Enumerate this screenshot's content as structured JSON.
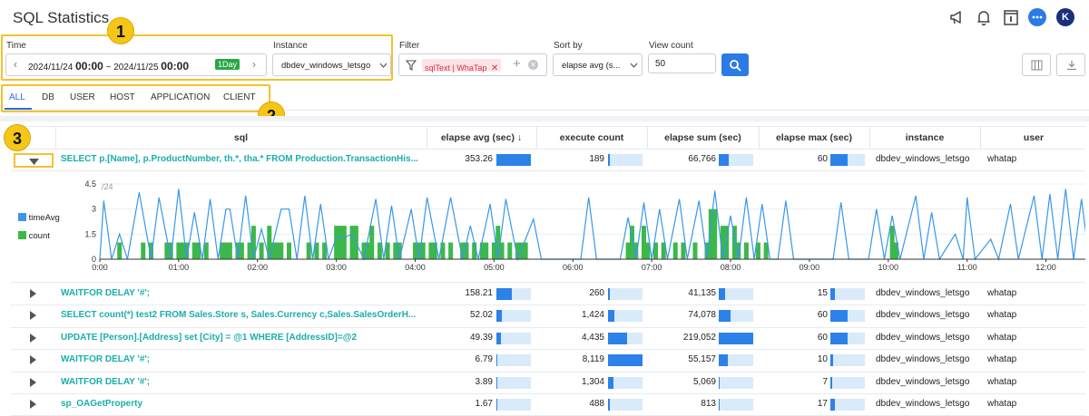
{
  "header": {
    "title": "SQL Statistics",
    "avatar_letter": "K"
  },
  "annotations": {
    "one": "1",
    "two": "2",
    "three": "3"
  },
  "filters": {
    "time_label": "Time",
    "time_start_date": "2024/11/24",
    "time_start_hm": "00:00",
    "time_sep": "~",
    "time_end_date": "2024/11/25",
    "time_end_hm": "00:00",
    "time_badge": "1Day",
    "instance_label": "Instance",
    "instance_value": "dbdev_windows_letsgo",
    "filter_label": "Filter",
    "filter_tag": "sqlText | WhaTap",
    "sort_label": "Sort by",
    "sort_value": "elapse avg (s...",
    "view_label": "View count",
    "view_value": "50"
  },
  "tabs": [
    "ALL",
    "DB",
    "USER",
    "HOST",
    "APPLICATION",
    "CLIENT"
  ],
  "columns": [
    "sql",
    "elapse avg (sec) ↓",
    "execute count",
    "elapse sum (sec)",
    "elapse max (sec)",
    "instance",
    "user"
  ],
  "expanded_row": {
    "sql": "SELECT p.[Name], p.ProductNumber, th.*, tha.* FROM Production.TransactionHis...",
    "elapse_avg": "353.26",
    "execute_count": "189",
    "elapse_sum": "66,766",
    "elapse_max": "60",
    "instance": "dbdev_windows_letsgo",
    "user": "whatap",
    "bars": [
      1.0,
      0.04,
      0.3,
      0.5
    ]
  },
  "rows": [
    {
      "sql": "WAITFOR DELAY '#';",
      "elapse_avg": "158.21",
      "execute_count": "260",
      "elapse_sum": "41,135",
      "elapse_max": "15",
      "instance": "dbdev_windows_letsgo",
      "user": "whatap",
      "bars": [
        0.45,
        0.05,
        0.19,
        0.12
      ]
    },
    {
      "sql": "SELECT count(*) test2 FROM Sales.Store s, Sales.Currency c,Sales.SalesOrderH...",
      "elapse_avg": "52.02",
      "execute_count": "1,424",
      "elapse_sum": "74,078",
      "elapse_max": "60",
      "instance": "dbdev_windows_letsgo",
      "user": "whatap",
      "bars": [
        0.15,
        0.18,
        0.34,
        0.5
      ]
    },
    {
      "sql": "UPDATE [Person].[Address] set [City] = @1 WHERE [AddressID]=@2",
      "elapse_avg": "49.39",
      "execute_count": "4,435",
      "elapse_sum": "219,052",
      "elapse_max": "60",
      "instance": "dbdev_windows_letsgo",
      "user": "whatap",
      "bars": [
        0.14,
        0.55,
        1.0,
        0.5
      ]
    },
    {
      "sql": "WAITFOR DELAY '#';",
      "elapse_avg": "6.79",
      "execute_count": "8,119",
      "elapse_sum": "55,157",
      "elapse_max": "10",
      "instance": "dbdev_windows_letsgo",
      "user": "whatap",
      "bars": [
        0.02,
        1.0,
        0.25,
        0.08
      ]
    },
    {
      "sql": "WAITFOR DELAY '#';",
      "elapse_avg": "3.89",
      "execute_count": "1,304",
      "elapse_sum": "5,069",
      "elapse_max": "7",
      "instance": "dbdev_windows_letsgo",
      "user": "whatap",
      "bars": [
        0.01,
        0.16,
        0.02,
        0.05
      ]
    },
    {
      "sql": "sp_OAGetProperty",
      "elapse_avg": "1.67",
      "execute_count": "488",
      "elapse_sum": "813",
      "elapse_max": "17",
      "instance": "dbdev_windows_letsgo",
      "user": "whatap",
      "bars": [
        0.005,
        0.06,
        0.004,
        0.14
      ]
    }
  ],
  "chart_data": {
    "type": "line",
    "legend": [
      "timeAvg",
      "count"
    ],
    "legend_placement": "left",
    "colors": {
      "timeAvg": "#3a97e8",
      "count": "#3cb84a"
    },
    "corner_label": "/24",
    "y_ticks": [
      "4.5",
      "3",
      "1.5",
      "0"
    ],
    "ylim": [
      0,
      4.5
    ],
    "x_ticks": [
      "0:00",
      "01:00",
      "02:00",
      "03:00",
      "04:00",
      "05:00",
      "06:00",
      "07:00",
      "08:00",
      "09:00",
      "10:00",
      "11:00",
      "12:00"
    ],
    "xlim_hours": [
      0,
      12.5
    ],
    "count_series": [
      [
        0.25,
        1
      ],
      [
        0.55,
        1
      ],
      [
        0.65,
        1
      ],
      [
        0.85,
        1
      ],
      [
        0.9,
        1
      ],
      [
        1.0,
        1
      ],
      [
        1.05,
        1
      ],
      [
        1.1,
        1
      ],
      [
        1.2,
        1
      ],
      [
        1.25,
        1
      ],
      [
        1.35,
        1
      ],
      [
        1.55,
        1
      ],
      [
        1.6,
        1
      ],
      [
        1.65,
        1
      ],
      [
        1.75,
        1
      ],
      [
        1.8,
        1
      ],
      [
        1.9,
        1
      ],
      [
        1.95,
        2
      ],
      [
        2.05,
        1
      ],
      [
        2.15,
        2
      ],
      [
        2.2,
        1
      ],
      [
        2.25,
        1
      ],
      [
        2.3,
        1
      ],
      [
        2.4,
        1
      ],
      [
        2.65,
        1
      ],
      [
        2.75,
        1
      ],
      [
        2.85,
        1
      ],
      [
        3.0,
        2
      ],
      [
        3.05,
        2
      ],
      [
        3.1,
        2
      ],
      [
        3.2,
        2
      ],
      [
        3.25,
        2
      ],
      [
        3.35,
        1
      ],
      [
        3.4,
        1
      ],
      [
        3.45,
        2
      ],
      [
        3.55,
        1
      ],
      [
        3.65,
        1
      ],
      [
        3.75,
        1
      ],
      [
        3.8,
        1
      ],
      [
        4.0,
        1
      ],
      [
        4.05,
        1
      ],
      [
        4.1,
        1
      ],
      [
        4.2,
        1
      ],
      [
        4.25,
        1
      ],
      [
        4.35,
        1
      ],
      [
        4.45,
        1
      ],
      [
        4.6,
        1
      ],
      [
        4.65,
        1
      ],
      [
        4.75,
        1
      ],
      [
        4.85,
        1
      ],
      [
        4.9,
        1
      ],
      [
        5.0,
        1
      ],
      [
        5.05,
        2
      ],
      [
        5.1,
        1
      ],
      [
        5.2,
        1
      ],
      [
        5.3,
        1
      ],
      [
        5.35,
        1
      ],
      [
        5.4,
        1
      ],
      [
        6.7,
        1
      ],
      [
        6.75,
        2
      ],
      [
        6.8,
        1
      ],
      [
        6.9,
        2
      ],
      [
        6.95,
        1
      ],
      [
        7.05,
        1
      ],
      [
        7.15,
        1
      ],
      [
        7.3,
        1
      ],
      [
        7.4,
        1
      ],
      [
        7.55,
        1
      ],
      [
        7.7,
        1
      ],
      [
        7.75,
        3
      ],
      [
        7.8,
        3
      ],
      [
        7.9,
        2
      ],
      [
        7.95,
        2
      ],
      [
        8.05,
        2
      ],
      [
        8.1,
        1
      ],
      [
        8.2,
        1
      ],
      [
        8.35,
        1
      ],
      [
        8.45,
        1
      ],
      [
        10.05,
        2
      ],
      [
        10.1,
        1
      ],
      [
        12.55,
        1
      ],
      [
        12.6,
        1
      ]
    ],
    "timeavg_series": [
      [
        0,
        0
      ],
      [
        0.05,
        3.5
      ],
      [
        0.15,
        0
      ],
      [
        0.25,
        1.5
      ],
      [
        0.35,
        0
      ],
      [
        0.5,
        4.0
      ],
      [
        0.65,
        0
      ],
      [
        0.75,
        3.7
      ],
      [
        0.9,
        0
      ],
      [
        1.0,
        4.2
      ],
      [
        1.1,
        0
      ],
      [
        1.2,
        2.8
      ],
      [
        1.3,
        0
      ],
      [
        1.4,
        3.6
      ],
      [
        1.5,
        0
      ],
      [
        1.6,
        3.0
      ],
      [
        1.65,
        3.0
      ],
      [
        1.75,
        0
      ],
      [
        1.85,
        3.8
      ],
      [
        1.95,
        0
      ],
      [
        2.05,
        1.8
      ],
      [
        2.15,
        0
      ],
      [
        2.3,
        3.0
      ],
      [
        2.4,
        3.0
      ],
      [
        2.5,
        0
      ],
      [
        2.6,
        3.8
      ],
      [
        2.7,
        0
      ],
      [
        2.8,
        3.3
      ],
      [
        2.9,
        0
      ],
      [
        3.0,
        1.3
      ],
      [
        3.1,
        1.3
      ],
      [
        3.2,
        1.5
      ],
      [
        3.35,
        0
      ],
      [
        3.5,
        3.6
      ],
      [
        3.6,
        0
      ],
      [
        3.7,
        3.2
      ],
      [
        3.8,
        0
      ],
      [
        3.95,
        3.0
      ],
      [
        4.05,
        0
      ],
      [
        4.15,
        3.7
      ],
      [
        4.3,
        0
      ],
      [
        4.45,
        3.7
      ],
      [
        4.6,
        0
      ],
      [
        4.7,
        2.0
      ],
      [
        4.8,
        0
      ],
      [
        4.95,
        3.3
      ],
      [
        5.05,
        0
      ],
      [
        5.15,
        3.6
      ],
      [
        5.3,
        0
      ],
      [
        5.5,
        2.4
      ],
      [
        5.6,
        0
      ],
      [
        6.1,
        0
      ],
      [
        6.2,
        3.7
      ],
      [
        6.3,
        0
      ],
      [
        6.6,
        0
      ],
      [
        6.7,
        2.5
      ],
      [
        6.8,
        0
      ],
      [
        6.9,
        3.4
      ],
      [
        7.0,
        0
      ],
      [
        7.1,
        3.0
      ],
      [
        7.2,
        0
      ],
      [
        7.35,
        3.6
      ],
      [
        7.45,
        0
      ],
      [
        7.6,
        3.5
      ],
      [
        7.7,
        0
      ],
      [
        7.8,
        4.1
      ],
      [
        7.9,
        0
      ],
      [
        8.0,
        2.6
      ],
      [
        8.1,
        0
      ],
      [
        8.2,
        3.7
      ],
      [
        8.3,
        0
      ],
      [
        8.4,
        3.3
      ],
      [
        8.5,
        0
      ],
      [
        8.6,
        0
      ],
      [
        8.7,
        3.5
      ],
      [
        8.8,
        0
      ],
      [
        9.3,
        0
      ],
      [
        9.4,
        3.4
      ],
      [
        9.5,
        0
      ],
      [
        9.75,
        0
      ],
      [
        9.85,
        3.0
      ],
      [
        9.95,
        0
      ],
      [
        10.05,
        2.6
      ],
      [
        10.15,
        0
      ],
      [
        10.35,
        3.8
      ],
      [
        10.45,
        0
      ],
      [
        10.55,
        2.8
      ],
      [
        10.65,
        0
      ],
      [
        10.85,
        1.5
      ],
      [
        10.95,
        0
      ],
      [
        11.0,
        3.7
      ],
      [
        11.1,
        0
      ],
      [
        11.3,
        1.2
      ],
      [
        11.4,
        0
      ],
      [
        11.55,
        3.3
      ],
      [
        11.65,
        0
      ],
      [
        11.85,
        3.8
      ],
      [
        11.95,
        0
      ],
      [
        12.05,
        3.9
      ],
      [
        12.15,
        0
      ],
      [
        12.25,
        4.2
      ],
      [
        12.35,
        0
      ],
      [
        12.45,
        3.6
      ],
      [
        12.55,
        0
      ],
      [
        12.6,
        3.0
      ]
    ]
  },
  "colors": {
    "accent": "#2a6fdb",
    "sql_text": "#1aaea8",
    "bar": "#2c82e8",
    "bar_bg": "#d9eafb",
    "highlight": "#f2c230",
    "day_badge": "#28a745"
  }
}
